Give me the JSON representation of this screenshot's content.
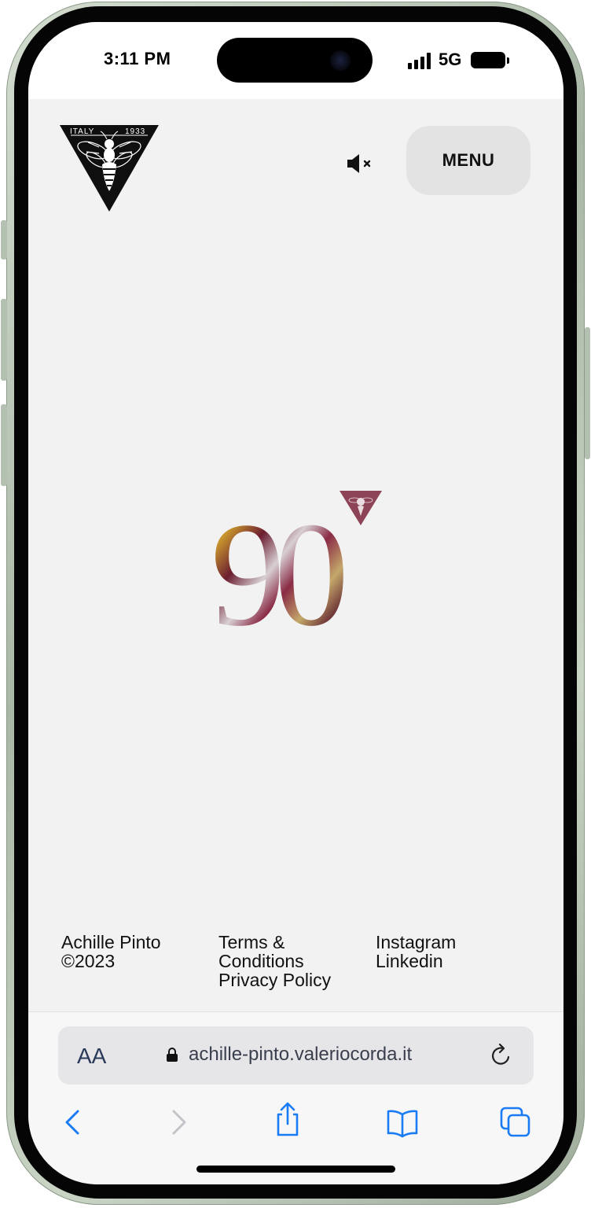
{
  "status_bar": {
    "time": "3:11 PM",
    "network": "5G",
    "icons": [
      "signal-icon",
      "battery-icon"
    ]
  },
  "header": {
    "logo": {
      "icon": "bee-triangle-logo",
      "left_text": "ITALY",
      "right_text": "1933"
    },
    "mute_icon": "speaker-muted-icon",
    "menu_label": "MENU"
  },
  "hero": {
    "emblem_text": "90",
    "emblem_icon": "bee-triangle-badge"
  },
  "footer": {
    "brand": "Achille Pinto",
    "copyright": "©2023",
    "legal_links": [
      "Terms &",
      "Conditions",
      "Privacy Policy"
    ],
    "social_links": [
      "Instagram",
      "Linkedin"
    ]
  },
  "browser": {
    "text_size_label": "AA",
    "url": "achille-pinto.valeriocorda.it",
    "toolbar": [
      "back-icon",
      "forward-icon",
      "share-icon",
      "bookmarks-icon",
      "tabs-icon"
    ]
  },
  "colors": {
    "page_background": "#f2f2f2",
    "menu_button": "#e3e3e3",
    "link_blue": "#1a7cf5",
    "disabled_gray": "#c4c4c8"
  }
}
